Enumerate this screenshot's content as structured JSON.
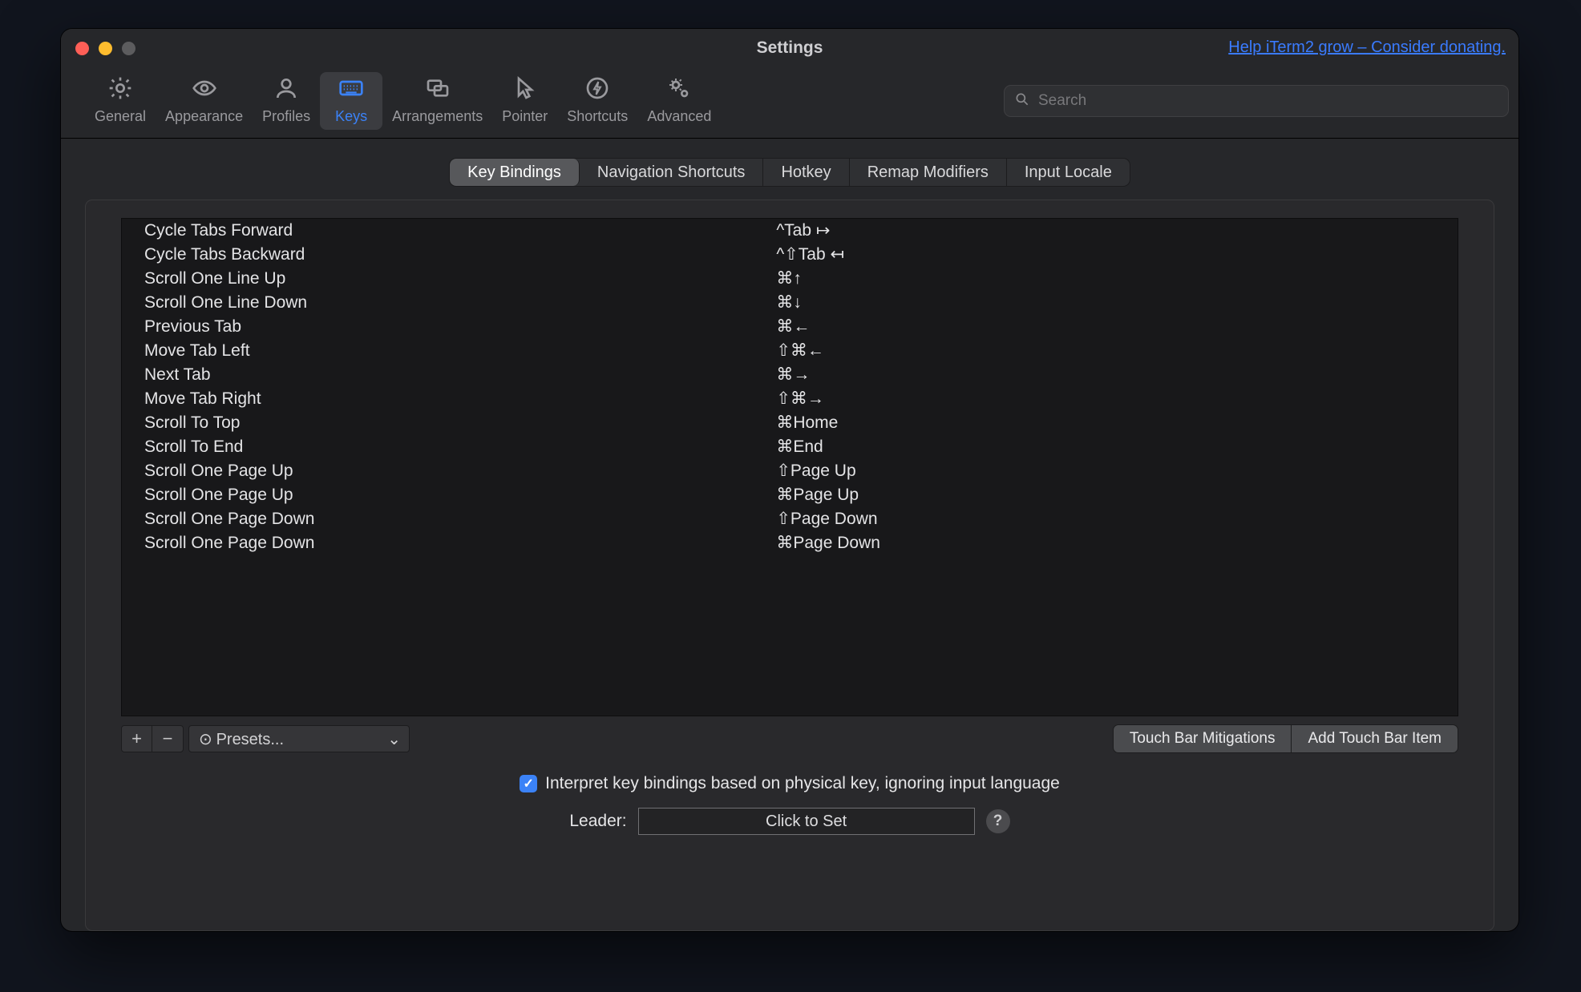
{
  "window": {
    "title": "Settings",
    "donate_link": "Help iTerm2 grow – Consider donating."
  },
  "search": {
    "placeholder": "Search"
  },
  "toolbar": [
    {
      "id": "general",
      "label": "General"
    },
    {
      "id": "appearance",
      "label": "Appearance"
    },
    {
      "id": "profiles",
      "label": "Profiles"
    },
    {
      "id": "keys",
      "label": "Keys",
      "active": true
    },
    {
      "id": "arrangements",
      "label": "Arrangements"
    },
    {
      "id": "pointer",
      "label": "Pointer"
    },
    {
      "id": "shortcuts",
      "label": "Shortcuts"
    },
    {
      "id": "advanced",
      "label": "Advanced"
    }
  ],
  "subtabs": [
    {
      "id": "key-bindings",
      "label": "Key Bindings",
      "active": true
    },
    {
      "id": "navigation-shortcuts",
      "label": "Navigation Shortcuts"
    },
    {
      "id": "hotkey",
      "label": "Hotkey"
    },
    {
      "id": "remap-modifiers",
      "label": "Remap Modifiers"
    },
    {
      "id": "input-locale",
      "label": "Input Locale"
    }
  ],
  "bindings": [
    {
      "action": "Cycle Tabs Forward",
      "shortcut": "^Tab ↦"
    },
    {
      "action": "Cycle Tabs Backward",
      "shortcut": "^⇧Tab ↤"
    },
    {
      "action": "Scroll One Line Up",
      "shortcut": "⌘↑"
    },
    {
      "action": "Scroll One Line Down",
      "shortcut": "⌘↓"
    },
    {
      "action": "Previous Tab",
      "shortcut": "⌘←"
    },
    {
      "action": "Move Tab Left",
      "shortcut": "⇧⌘←"
    },
    {
      "action": "Next Tab",
      "shortcut": "⌘→"
    },
    {
      "action": "Move Tab Right",
      "shortcut": "⇧⌘→"
    },
    {
      "action": "Scroll To Top",
      "shortcut": "⌘Home"
    },
    {
      "action": "Scroll To End",
      "shortcut": "⌘End"
    },
    {
      "action": "Scroll One Page Up",
      "shortcut": "⇧Page Up"
    },
    {
      "action": "Scroll One Page Up",
      "shortcut": "⌘Page Up"
    },
    {
      "action": "Scroll One Page Down",
      "shortcut": "⇧Page Down"
    },
    {
      "action": "Scroll One Page Down",
      "shortcut": "⌘Page Down"
    }
  ],
  "buttons": {
    "presets_label": "Presets...",
    "touchbar_mitigations": "Touch Bar Mitigations",
    "add_touchbar_item": "Add Touch Bar Item"
  },
  "interpret_checkbox": {
    "checked": true,
    "label": "Interpret key bindings based on physical key, ignoring input language"
  },
  "leader": {
    "label": "Leader:",
    "placeholder": "Click to Set"
  }
}
